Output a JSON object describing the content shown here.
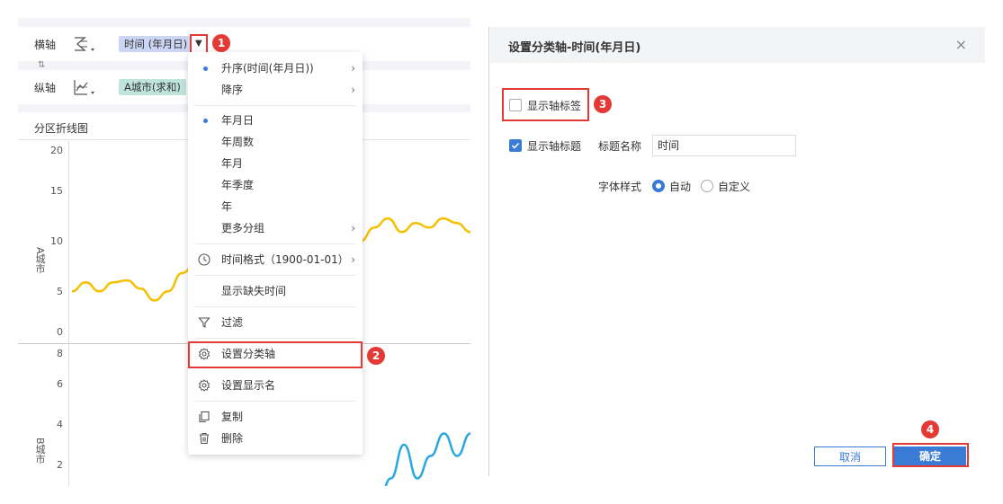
{
  "toolbar": {
    "x_axis_label": "横轴",
    "y_axis_label": "纵轴",
    "x_field": "时间 (年月日)",
    "y_field": "A城市(求和)",
    "dropdown_glyph": "▼",
    "swap_glyph": "⇅"
  },
  "chart": {
    "title": "分区折线图",
    "top_panel_ylabel": "A城市",
    "bottom_panel_ylabel": "B城市",
    "line_colors": {
      "top": "#f5c000",
      "bottom": "#2aa7e0"
    }
  },
  "chart_data": [
    {
      "type": "line",
      "ylabel": "A城市",
      "y_ticks": [
        "20",
        "15",
        "10",
        "5",
        "0"
      ],
      "ylim": [
        0,
        20
      ],
      "series": [
        {
          "values": [
            4.5,
            5.5,
            4.5,
            5.5,
            5.7,
            4.8,
            3.5,
            4.5,
            6.5,
            7.5,
            8.0,
            7.5,
            8.0,
            7.8,
            8.5,
            9.0,
            8.5,
            9.5,
            9.0,
            10.0,
            11.0,
            10.0,
            11.5,
            12.5,
            11.0,
            12.0,
            11.5,
            12.5,
            12.0,
            11.0
          ]
        }
      ]
    },
    {
      "type": "line",
      "ylabel": "B城市",
      "y_ticks": [
        "8",
        "6",
        "4",
        "2"
      ],
      "ylim": [
        0,
        8
      ],
      "series": [
        {
          "values": [
            null,
            null,
            null,
            null,
            null,
            null,
            null,
            null,
            null,
            null,
            null,
            null,
            null,
            null,
            null,
            null,
            null,
            null,
            null,
            null,
            null,
            null,
            0.5,
            1.2,
            2.5,
            4.0,
            2.5,
            3.5,
            4.5,
            3.5,
            4.5
          ]
        }
      ]
    }
  ],
  "menu": {
    "items": [
      {
        "label": "升序(时间(年月日))",
        "dot": true,
        "arrow": "›"
      },
      {
        "label": "降序",
        "dot": false,
        "arrow": "›"
      },
      {
        "label": "年月日",
        "dot": true
      },
      {
        "label": "年周数"
      },
      {
        "label": "年月"
      },
      {
        "label": "年季度"
      },
      {
        "label": "年"
      },
      {
        "label": "更多分组",
        "arrow": "›"
      },
      {
        "label": "时间格式（1900-01-01）",
        "arrow": "›",
        "icon": "clock-icon"
      },
      {
        "label": "显示缺失时间"
      },
      {
        "label": "过滤",
        "icon": "filter-icon"
      },
      {
        "label": "设置分类轴",
        "icon": "gear-icon"
      },
      {
        "label": "设置显示名",
        "icon": "gear-icon"
      },
      {
        "label": "复制",
        "icon": "copy-icon"
      },
      {
        "label": "删除",
        "icon": "trash-icon"
      }
    ]
  },
  "badges": [
    "1",
    "2",
    "3",
    "4"
  ],
  "dialog": {
    "title": "设置分类轴-时间(年月日)",
    "close": "×",
    "show_axis_labels": {
      "label": "显示轴标签",
      "checked": false
    },
    "show_axis_title": {
      "label": "显示轴标题",
      "checked": true
    },
    "title_name_label": "标题名称",
    "title_name_value": "时间",
    "font_style_label": "字体样式",
    "font_options": [
      {
        "label": "自动",
        "selected": true
      },
      {
        "label": "自定义",
        "selected": false
      }
    ],
    "cancel_label": "取消",
    "ok_label": "确定"
  }
}
